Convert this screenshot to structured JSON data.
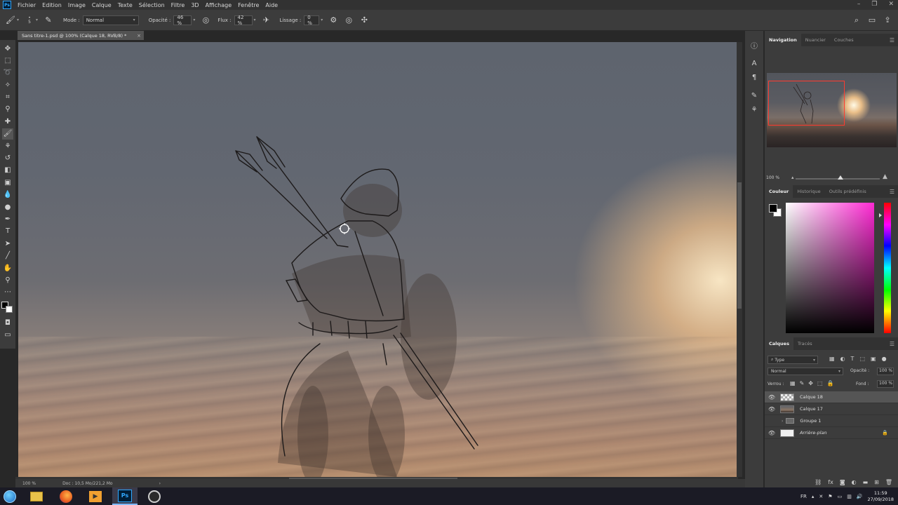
{
  "app": {
    "logo_text": "Ps",
    "menu": [
      "Fichier",
      "Edition",
      "Image",
      "Calque",
      "Texte",
      "Sélection",
      "Filtre",
      "3D",
      "Affichage",
      "Fenêtre",
      "Aide"
    ],
    "window_controls": [
      "–",
      "❐",
      "✕"
    ]
  },
  "options_bar": {
    "brush_size": "5",
    "mode_label": "Mode :",
    "mode_value": "Normal",
    "opacity_label": "Opacité :",
    "opacity_value": "46 %",
    "flow_label": "Flux :",
    "flow_value": "42 %",
    "smoothing_label": "Lissage :",
    "smoothing_value": "0 %"
  },
  "document": {
    "tab_title": "Sans titre-1.psd @ 100% (Calque 18, RVB/8) *",
    "tab_close": "×"
  },
  "status_bar": {
    "zoom": "100 %",
    "doc_size": "Doc : 10,5 Mo/221,2 Mo",
    "arrow": "›"
  },
  "navigator_panel": {
    "tabs": [
      "Navigation",
      "Nuancier",
      "Couches"
    ],
    "zoom": "100 %"
  },
  "color_panel": {
    "tabs": [
      "Couleur",
      "Historique",
      "Outils prédéfinis"
    ],
    "foreground": "#000000",
    "background": "#ffffff",
    "hue_color": "#ff2ad4"
  },
  "layers_panel": {
    "tabs": [
      "Calques",
      "Tracés"
    ],
    "filter_value": "Type",
    "blend_mode": "Normal",
    "opacity_label": "Opacité :",
    "opacity_value": "100 %",
    "lock_label": "Verrou :",
    "fill_label": "Fond :",
    "fill_value": "100 %",
    "layers": [
      {
        "name": "Calque 18",
        "visible": true,
        "selected": true
      },
      {
        "name": "Calque 17",
        "visible": true,
        "selected": false
      },
      {
        "name": "Groupe 1",
        "visible": false,
        "selected": false
      },
      {
        "name": "Arrière-plan",
        "visible": true,
        "selected": false
      }
    ],
    "footer_icons": [
      "link-icon",
      "fx-icon",
      "mask-icon",
      "adjustment-icon",
      "folder-icon",
      "new-layer-icon",
      "trash-icon"
    ]
  },
  "taskbar": {
    "tray_lang": "FR",
    "time": "11:59",
    "date": "27/09/2018"
  }
}
